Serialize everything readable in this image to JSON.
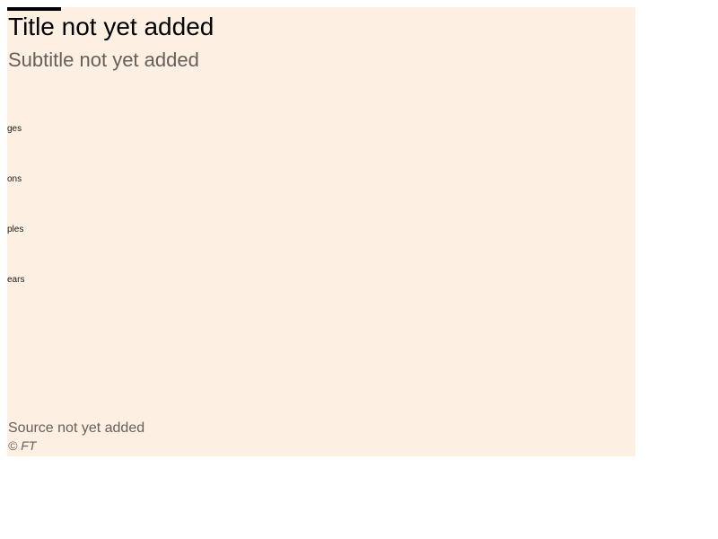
{
  "header": {
    "title": "Title not yet added",
    "subtitle": "Subtitle not yet added"
  },
  "footer": {
    "source": "Source not yet added",
    "copyright": "© FT"
  },
  "colors": {
    "background": "#fdf0e2",
    "title": "#000000",
    "muted_text": "#66605c",
    "brand_bar": "#000000"
  },
  "chart_data": {
    "type": "bar",
    "categories": [
      "ges",
      "ons",
      "ples",
      "ears"
    ],
    "values": []
  }
}
